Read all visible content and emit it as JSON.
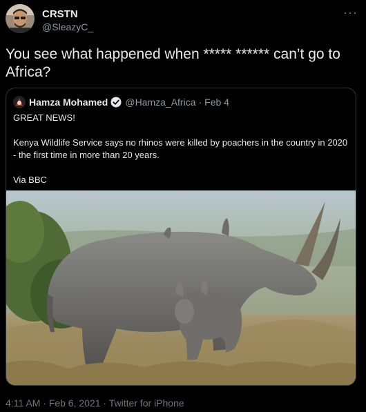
{
  "author": {
    "name": "CRSTN",
    "handle": "@SleazyC_"
  },
  "tweet": {
    "text": "You see what happened when ***** ****** can’t go to Africa?"
  },
  "quoted_tweet": {
    "author_name": "Hamza Mohamed",
    "author_handle": "@Hamza_Africa",
    "separator": "·",
    "date": "Feb 4",
    "paragraphs": [
      "GREAT NEWS!",
      "Kenya Wildlife Service says no rhinos were killed by poachers in the country in 2020 - the first time in more than 20 years.",
      "Via BBC"
    ]
  },
  "footer": {
    "time": "4:11 AM",
    "separator": "·",
    "date": "Feb 6, 2021",
    "separator2": "·",
    "client": "Twitter for iPhone"
  },
  "icons": {
    "more": "more-options-icon",
    "verified": "verified-badge-icon"
  },
  "colors": {
    "background": "#000000",
    "primary_text": "#e7e9ea",
    "secondary_text": "#8b98a5",
    "border": "#333639",
    "verified": "#1d9bf0"
  }
}
